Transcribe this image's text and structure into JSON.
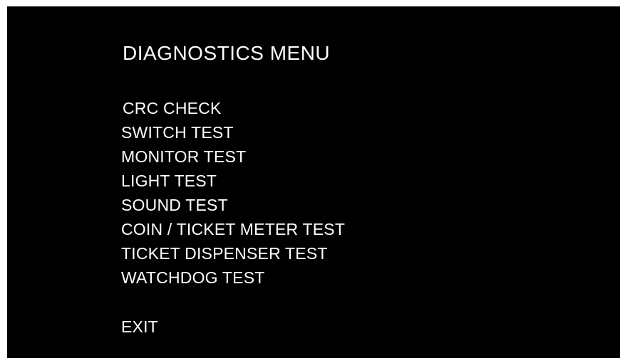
{
  "menu": {
    "title": "DIAGNOSTICS MENU",
    "items": [
      {
        "label": "CRC CHECK"
      },
      {
        "label": "SWITCH TEST"
      },
      {
        "label": "MONITOR TEST"
      },
      {
        "label": "LIGHT TEST"
      },
      {
        "label": "SOUND TEST"
      },
      {
        "label": "COIN / TICKET METER TEST"
      },
      {
        "label": "TICKET DISPENSER TEST"
      },
      {
        "label": "WATCHDOG TEST"
      }
    ],
    "exit_label": "EXIT"
  },
  "colors": {
    "background": "#000000",
    "text": "#ffffff"
  }
}
